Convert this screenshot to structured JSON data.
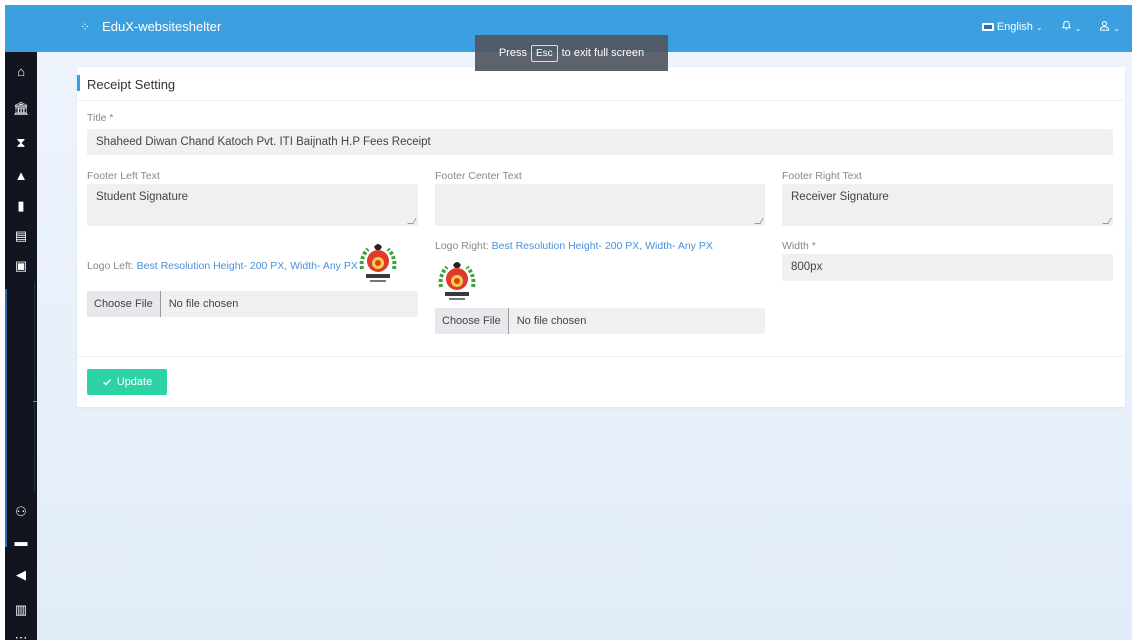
{
  "app": {
    "title": "EduX-websiteshelter",
    "language": "English"
  },
  "fullscreen_toast": {
    "prefix": "Press",
    "key": "Esc",
    "suffix": "to exit full screen"
  },
  "sidebar": {
    "icons": [
      "home-icon",
      "bank-icon",
      "hourglass-icon",
      "graduation-cap-icon",
      "file-icon",
      "list-icon",
      "image-icon",
      "users-icon",
      "card-icon",
      "megaphone-icon",
      "book-icon",
      "more-icon"
    ]
  },
  "card": {
    "heading": "Receipt Setting"
  },
  "form": {
    "title_label": "Title",
    "required_mark": "*",
    "title_value": "Shaheed Diwan Chand Katoch Pvt. ITI Baijnath H.P Fees Receipt",
    "footer_left_label": "Footer Left Text",
    "footer_left_value": "Student Signature",
    "footer_center_label": "Footer Center Text",
    "footer_center_value": "",
    "footer_right_label": "Footer Right Text",
    "footer_right_value": "Receiver Signature",
    "logo_left_label": "Logo Left:",
    "logo_left_hint": "Best Resolution Height- 200 PX, Width- Any PX",
    "logo_right_label": "Logo Right:",
    "logo_right_hint": "Best Resolution Height- 200 PX, Width- Any PX",
    "choose_file": "Choose File",
    "no_file": "No file chosen",
    "width_label": "Width",
    "width_value": "800px",
    "update_label": "Update"
  },
  "colors": {
    "topbar": "#3c9fe0",
    "sidebar": "#12151f",
    "update": "#2ed3a5",
    "hint": "#4a90d9"
  }
}
